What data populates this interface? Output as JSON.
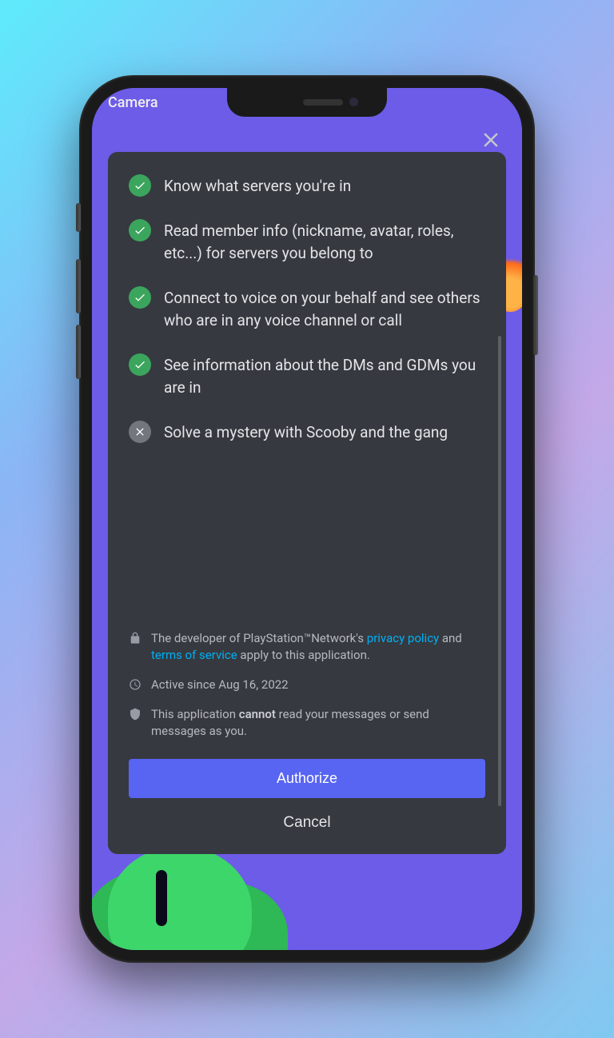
{
  "appBar": {
    "title": "Camera"
  },
  "permissions": [
    {
      "granted": true,
      "text": "Know what servers you're in"
    },
    {
      "granted": true,
      "text": "Read member info (nickname, avatar, roles, etc...) for servers you belong to"
    },
    {
      "granted": true,
      "text": "Connect to voice on your behalf and see others who are in any voice channel or call"
    },
    {
      "granted": true,
      "text": "See information about the DMs and GDMs you are in"
    },
    {
      "granted": false,
      "text": "Solve a mystery with Scooby and the gang"
    }
  ],
  "footer": {
    "developer_prefix": "The developer of PlayStation™Network's ",
    "privacy_link": "privacy policy",
    "and_word": " and ",
    "tos_link": "terms of service",
    "developer_suffix": " apply to this application.",
    "active_since": "Active since Aug 16, 2022",
    "cannot_prefix": "This application ",
    "cannot_word": "cannot",
    "cannot_suffix": " read your messages or send messages as you."
  },
  "buttons": {
    "authorize": "Authorize",
    "cancel": "Cancel"
  }
}
